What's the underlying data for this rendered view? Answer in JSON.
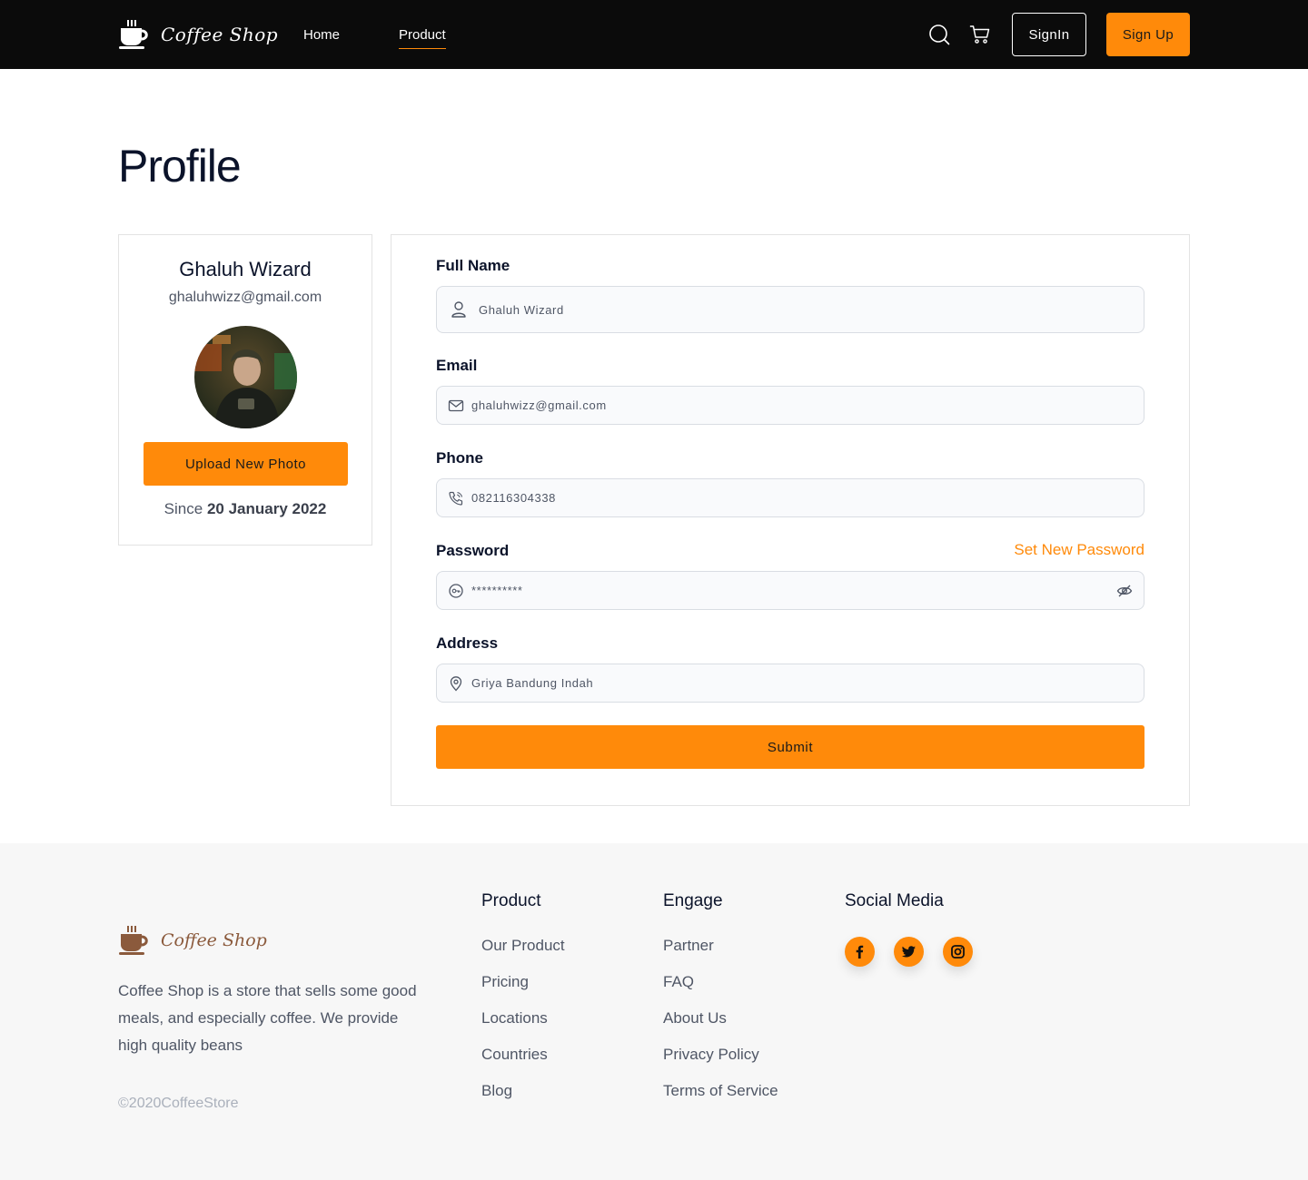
{
  "brand": {
    "name": "Coffee Shop"
  },
  "nav": {
    "links": [
      "Home",
      "Product"
    ],
    "active": "Product",
    "search_icon": "search-icon",
    "cart_icon": "cart-icon",
    "signin_label": "SignIn",
    "signup_label": "Sign Up"
  },
  "page": {
    "title": "Profile"
  },
  "profile": {
    "name": "Ghaluh Wizard",
    "email": "ghaluhwizz@gmail.com",
    "upload_label": "Upload New Photo",
    "since_prefix": "Since",
    "since_date": "20 January 2022"
  },
  "form": {
    "full_name": {
      "label": "Full Name",
      "value": "Ghaluh Wizard",
      "icon": "user-icon"
    },
    "email": {
      "label": "Email",
      "value": "ghaluhwizz@gmail.com",
      "icon": "mail-icon"
    },
    "phone": {
      "label": "Phone",
      "value": "082116304338",
      "icon": "phone-icon"
    },
    "password": {
      "label": "Password",
      "value": "**********",
      "icon": "key-icon",
      "toggle_icon": "eye-off-icon",
      "set_new_label": "Set New Password"
    },
    "address": {
      "label": "Address",
      "value": "Griya Bandung Indah",
      "icon": "location-pin-icon"
    },
    "submit_label": "Submit"
  },
  "footer": {
    "brand": "Coffee Shop",
    "description": "Coffee Shop is a store that sells some good meals, and especially coffee. We provide high quality beans",
    "copyright": "©2020CoffeeStore",
    "columns": [
      {
        "title": "Product",
        "items": [
          "Our Product",
          "Pricing",
          "Locations",
          "Countries",
          "Blog"
        ]
      },
      {
        "title": "Engage",
        "items": [
          "Partner",
          "FAQ",
          "About Us",
          "Privacy Policy",
          "Terms of Service"
        ]
      }
    ],
    "social": {
      "title": "Social Media",
      "icons": [
        "facebook-icon",
        "twitter-icon",
        "instagram-icon"
      ]
    }
  },
  "colors": {
    "accent": "#ff8a0a",
    "nav_bg": "#0b0b0b",
    "footer_bg": "#f7f7f7",
    "text_dark": "#0b132a",
    "text_muted": "#4f5665"
  }
}
